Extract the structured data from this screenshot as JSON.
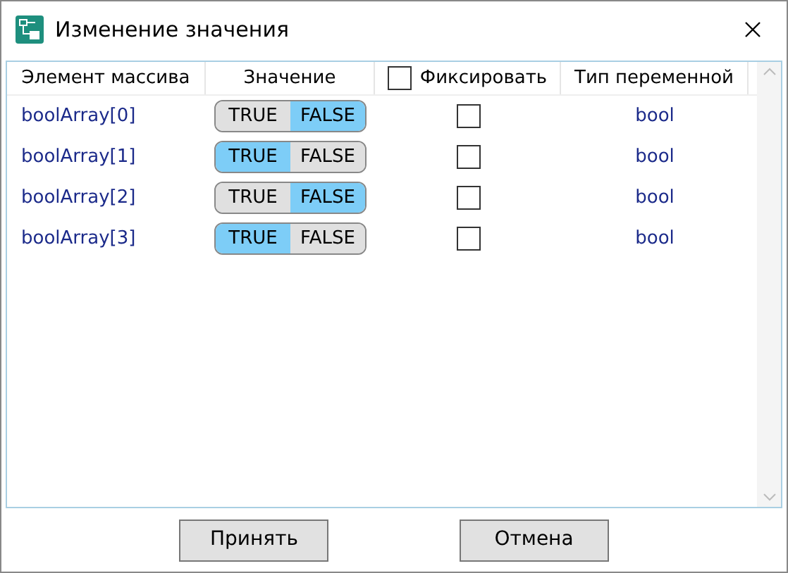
{
  "window": {
    "title": "Изменение значения"
  },
  "table": {
    "columns": [
      {
        "label": "Элемент массива"
      },
      {
        "label": "Значение"
      },
      {
        "label": "Фиксировать",
        "checked": false
      },
      {
        "label": "Тип переменной"
      }
    ],
    "rows": [
      {
        "element": "boolArray[0]",
        "true_label": "TRUE",
        "false_label": "FALSE",
        "value": false,
        "fixed": false,
        "type": "bool"
      },
      {
        "element": "boolArray[1]",
        "true_label": "TRUE",
        "false_label": "FALSE",
        "value": true,
        "fixed": false,
        "type": "bool"
      },
      {
        "element": "boolArray[2]",
        "true_label": "TRUE",
        "false_label": "FALSE",
        "value": false,
        "fixed": false,
        "type": "bool"
      },
      {
        "element": "boolArray[3]",
        "true_label": "TRUE",
        "false_label": "FALSE",
        "value": true,
        "fixed": false,
        "type": "bool"
      }
    ]
  },
  "buttons": [
    {
      "label": "Принять"
    },
    {
      "label": "Отмена"
    }
  ]
}
